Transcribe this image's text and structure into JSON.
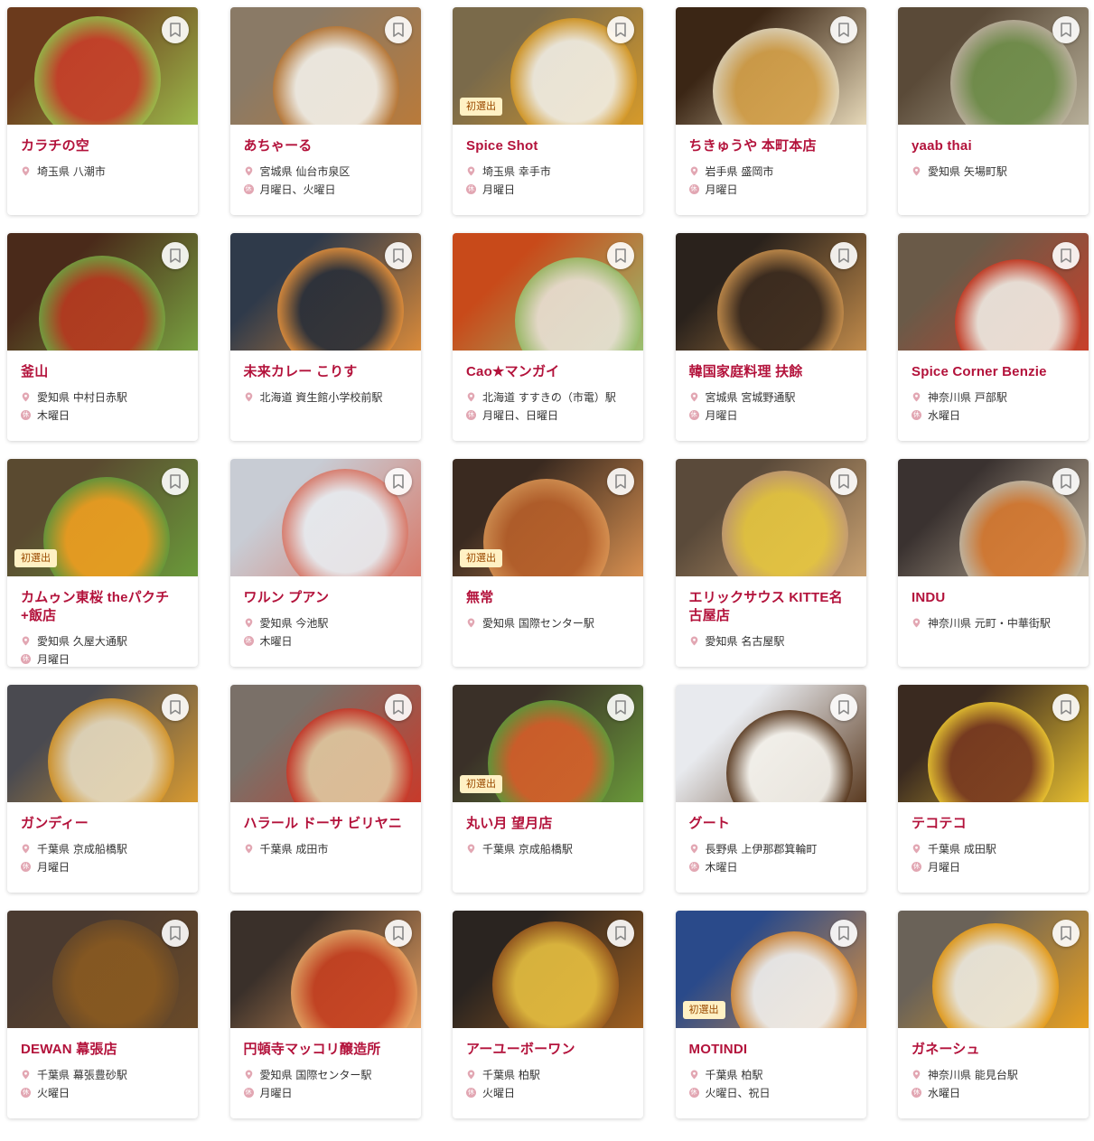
{
  "bookmark_icon": "bookmark-icon",
  "location_icon": "map-pin-icon",
  "holiday_icon_label": "休",
  "colors": {
    "name": "#b3123b",
    "pin": "#e2a7b3",
    "badge_bg": "#fff1c4"
  },
  "shops": [
    {
      "name": "カラチの空",
      "location": "埼玉県 八潮市",
      "holiday": "",
      "badge": "",
      "photo": [
        "#6b3a1c",
        "#c8402a",
        "#9bb84a"
      ]
    },
    {
      "name": "あちゃーる",
      "location": "宮城県 仙台市泉区",
      "holiday": "月曜日、火曜日",
      "badge": "",
      "photo": [
        "#8a7a66",
        "#f3f1ea",
        "#b97a3a"
      ]
    },
    {
      "name": "Spice Shot",
      "location": "埼玉県 幸手市",
      "holiday": "月曜日",
      "badge": "初選出",
      "photo": [
        "#7a6a4a",
        "#f2efe6",
        "#d69a2a"
      ]
    },
    {
      "name": "ちきゅうや 本町本店",
      "location": "岩手県 盛岡市",
      "holiday": "月曜日",
      "badge": "",
      "photo": [
        "#3b2615",
        "#d6a24a",
        "#e6d8b8"
      ]
    },
    {
      "name": "yaab thai",
      "location": "愛知県 矢場町駅",
      "holiday": "",
      "badge": "",
      "photo": [
        "#5a4a38",
        "#6f8f4a",
        "#b8b09a"
      ]
    },
    {
      "name": "釜山",
      "location": "愛知県 中村日赤駅",
      "holiday": "木曜日",
      "badge": "",
      "photo": [
        "#4a2a1a",
        "#b83a20",
        "#78a040"
      ]
    },
    {
      "name": "未来カレー こりす",
      "location": "北海道 資生館小学校前駅",
      "holiday": "",
      "badge": "",
      "photo": [
        "#2f3a4a",
        "#2a2f38",
        "#d98a3a"
      ]
    },
    {
      "name": "Cao★マンガイ",
      "location": "北海道 すすきの（市電）駅",
      "holiday": "月曜日、日曜日",
      "badge": "",
      "photo": [
        "#c84a1a",
        "#e8e2d6",
        "#9ac070"
      ]
    },
    {
      "name": "韓国家庭料理 扶餘",
      "location": "宮城県 宮城野通駅",
      "holiday": "月曜日",
      "badge": "",
      "photo": [
        "#2a221c",
        "#3a2a1e",
        "#c08a4a"
      ]
    },
    {
      "name": "Spice Corner Benzie",
      "location": "神奈川県 戸部駅",
      "holiday": "水曜日",
      "badge": "",
      "photo": [
        "#6a5a48",
        "#f0ece4",
        "#c8402a"
      ]
    },
    {
      "name": "カムゥン東桜 theパクチ+飯店",
      "location": "愛知県 久屋大通駅",
      "holiday": "月曜日",
      "badge": "初選出",
      "photo": [
        "#5a4a30",
        "#f0a020",
        "#6a9a3a"
      ]
    },
    {
      "name": "ワルン プアン",
      "location": "愛知県 今池駅",
      "holiday": "木曜日",
      "badge": "",
      "photo": [
        "#c8ccd4",
        "#e8ecf0",
        "#d87a6a"
      ]
    },
    {
      "name": "無常",
      "location": "愛知県 国際センター駅",
      "holiday": "",
      "badge": "初選出",
      "photo": [
        "#3a2a20",
        "#b8602a",
        "#d89050"
      ]
    },
    {
      "name": "エリックサウス KITTE名古屋店",
      "location": "愛知県 名古屋駅",
      "holiday": "",
      "badge": "",
      "photo": [
        "#5a4a3a",
        "#e8c840",
        "#c8a070"
      ]
    },
    {
      "name": "INDU",
      "location": "神奈川県 元町・中華街駅",
      "holiday": "",
      "badge": "",
      "photo": [
        "#3a3230",
        "#d87a30",
        "#c8b8a0"
      ]
    },
    {
      "name": "ガンディー",
      "location": "千葉県 京成船橋駅",
      "holiday": "月曜日",
      "badge": "",
      "photo": [
        "#4a4a50",
        "#e8dcc0",
        "#d89a30"
      ]
    },
    {
      "name": "ハラール ドーサ ビリヤニ",
      "location": "千葉県 成田市",
      "holiday": "",
      "badge": "",
      "photo": [
        "#7a7068",
        "#e0c8a0",
        "#c83a2a"
      ]
    },
    {
      "name": "丸い月 望月店",
      "location": "千葉県 京成船橋駅",
      "holiday": "",
      "badge": "初選出",
      "photo": [
        "#3a3028",
        "#d8602a",
        "#6a9a3a"
      ]
    },
    {
      "name": "グート",
      "location": "長野県 上伊那郡箕輪町",
      "holiday": "木曜日",
      "badge": "",
      "photo": [
        "#e8eaee",
        "#f6f4ee",
        "#5a3a20"
      ]
    },
    {
      "name": "テコテコ",
      "location": "千葉県 成田駅",
      "holiday": "月曜日",
      "badge": "",
      "photo": [
        "#3a2a20",
        "#7a3a20",
        "#e8c030"
      ]
    },
    {
      "name": "DEWAN 幕張店",
      "location": "千葉県 幕張豊砂駅",
      "holiday": "火曜日",
      "badge": "",
      "photo": [
        "#4a3a30",
        "#8a5a20",
        "#6a4a28"
      ]
    },
    {
      "name": "円頓寺マッコリ醸造所",
      "location": "愛知県 国際センター駅",
      "holiday": "月曜日",
      "badge": "",
      "photo": [
        "#3a302a",
        "#c84020",
        "#e8a060"
      ]
    },
    {
      "name": "アーユーボーワン",
      "location": "千葉県 柏駅",
      "holiday": "火曜日",
      "badge": "",
      "photo": [
        "#2a2420",
        "#e8c040",
        "#a06020"
      ]
    },
    {
      "name": "MOTINDI",
      "location": "千葉県 柏駅",
      "holiday": "火曜日、祝日",
      "badge": "初選出",
      "photo": [
        "#2a4a8a",
        "#f4f2ee",
        "#d89040"
      ]
    },
    {
      "name": "ガネーシュ",
      "location": "神奈川県 能見台駅",
      "holiday": "水曜日",
      "badge": "",
      "photo": [
        "#6a6258",
        "#f0ece0",
        "#e8a020"
      ]
    }
  ]
}
